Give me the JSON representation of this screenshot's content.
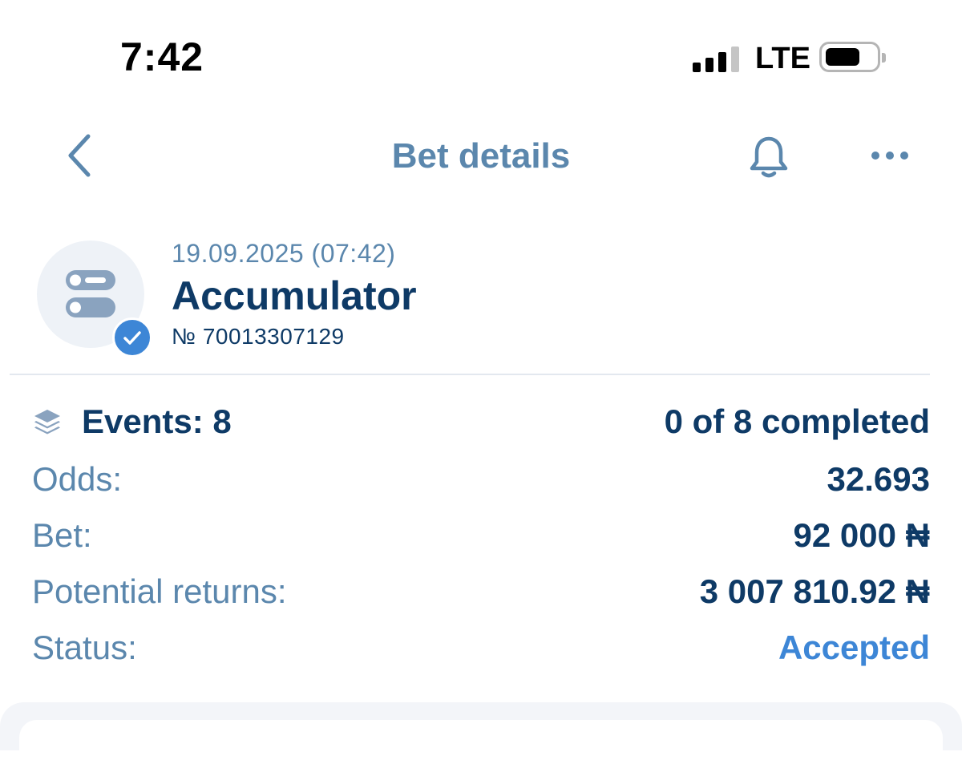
{
  "status_bar": {
    "time": "7:42",
    "network": "LTE"
  },
  "header": {
    "title": "Bet details"
  },
  "bet": {
    "date": "19.09.2025 (07:42)",
    "type": "Accumulator",
    "number": "№ 70013307129"
  },
  "details": {
    "events_label": "Events: 8",
    "events_value": "0 of 8 completed",
    "odds_label": "Odds:",
    "odds_value": "32.693",
    "bet_label": "Bet:",
    "bet_value": "92 000 ₦",
    "returns_label": "Potential returns:",
    "returns_value": "3 007 810.92 ₦",
    "status_label": "Status:",
    "status_value": "Accepted"
  },
  "colors": {
    "primary_text": "#0e3a66",
    "secondary_text": "#5b87ad",
    "accent": "#3d86d6"
  },
  "icons": [
    "back-chevron-icon",
    "bell-icon",
    "more-dots-icon",
    "accumulator-icon",
    "check-badge-icon",
    "layers-icon"
  ]
}
